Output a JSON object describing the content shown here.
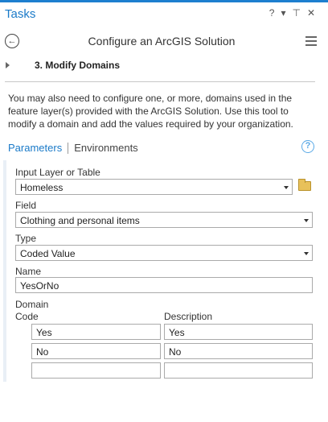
{
  "pane": {
    "title": "Tasks",
    "controls": {
      "help": "?",
      "dropdown": "▾",
      "pin": "⊤",
      "close": "✕"
    }
  },
  "header": {
    "title": "Configure an ArcGIS Solution",
    "back_icon": "back-arrow-icon",
    "menu_icon": "hamburger-menu-icon"
  },
  "step": {
    "label": "3.  Modify Domains"
  },
  "description": "You may also need to configure one, or more, domains used in the feature layer(s) provided with the ArcGIS Solution. Use this tool to modify a domain and add the values required by your organization.",
  "tabs": {
    "parameters": "Parameters",
    "environments": "Environments",
    "help": "?"
  },
  "form": {
    "input_layer": {
      "label": "Input Layer or Table",
      "value": "Homeless"
    },
    "field": {
      "label": "Field",
      "value": "Clothing and personal items"
    },
    "type": {
      "label": "Type",
      "value": "Coded Value"
    },
    "name": {
      "label": "Name",
      "value": "YesOrNo"
    },
    "domain": {
      "label": "Domain",
      "code_header": "Code",
      "description_header": "Description",
      "rows": [
        {
          "code": "Yes",
          "description": "Yes"
        },
        {
          "code": "No",
          "description": "No"
        },
        {
          "code": "",
          "description": ""
        }
      ]
    }
  },
  "colors": {
    "accent": "#1a7ac8",
    "topline": "#1d7fcf"
  }
}
